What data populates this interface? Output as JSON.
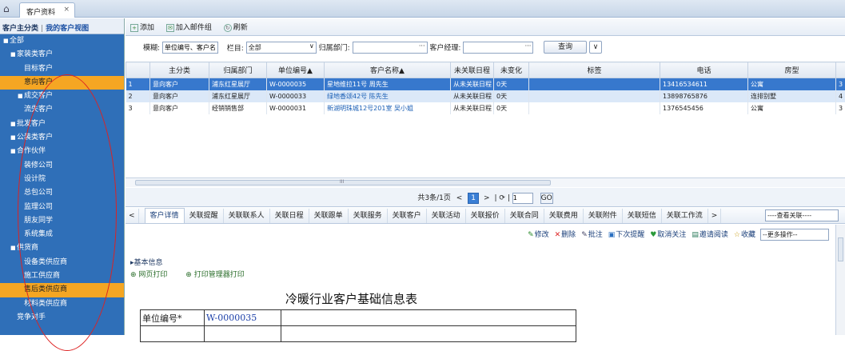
{
  "tabs": {
    "home_icon": "home-icon",
    "active_tab": "客户资料",
    "close": "×"
  },
  "sidebar": {
    "title": "客户主分类",
    "separator": "|",
    "view_link": "我的客户视图",
    "items": [
      {
        "label": "全部",
        "expander": "■",
        "level": 0
      },
      {
        "label": "家装类客户",
        "expander": "■",
        "level": 1
      },
      {
        "label": "目标客户",
        "expander": "",
        "level": 2
      },
      {
        "label": "意向客户",
        "expander": "",
        "level": 2,
        "selected": true
      },
      {
        "label": "成交客户",
        "expander": "■",
        "level": 2
      },
      {
        "label": "流失客户",
        "expander": "",
        "level": 2
      },
      {
        "label": "批发客户",
        "expander": "■",
        "level": 1
      },
      {
        "label": "公装类客户",
        "expander": "■",
        "level": 1
      },
      {
        "label": "合作伙伴",
        "expander": "■",
        "level": 1
      },
      {
        "label": "装修公司",
        "expander": "",
        "level": 2
      },
      {
        "label": "设计院",
        "expander": "",
        "level": 2
      },
      {
        "label": "总包公司",
        "expander": "",
        "level": 2
      },
      {
        "label": "监理公司",
        "expander": "",
        "level": 2
      },
      {
        "label": "朋友同学",
        "expander": "",
        "level": 2
      },
      {
        "label": "系统集成",
        "expander": "",
        "level": 2
      },
      {
        "label": "供货商",
        "expander": "■",
        "level": 1
      },
      {
        "label": "设备类供应商",
        "expander": "",
        "level": 2
      },
      {
        "label": "施工供应商",
        "expander": "",
        "level": 2
      },
      {
        "label": "售后类供应商",
        "expander": "",
        "level": 2,
        "selected": true
      },
      {
        "label": "材料类供应商",
        "expander": "",
        "level": 2
      },
      {
        "label": "竞争对手",
        "expander": "",
        "level": 1
      }
    ]
  },
  "toolbar": {
    "add": "添加",
    "add_mail": "加入邮件组",
    "refresh": "刷新"
  },
  "filter": {
    "fuzzy_label": "模糊:",
    "fuzzy_value": "单位编号、客户名称",
    "column_label": "栏目:",
    "column_value": "全部",
    "dept_label": "归属部门:",
    "dept_value": "",
    "dots": "···",
    "manager_label": "客户经理:",
    "manager_value": "",
    "query": "查询",
    "query_more": "∨"
  },
  "grid": {
    "headers": [
      "",
      "主分类",
      "归属部门",
      "单位编号▲",
      "客户名称▲",
      "未关联日程",
      "未变化",
      "标签",
      "电话",
      "房型",
      ""
    ],
    "rows": [
      [
        "1",
        "意向客户",
        "浦东红星展厅",
        "W-0000035",
        "星地维拉11号 周先生",
        "从未关联日程",
        "0天",
        "",
        "13416534611",
        "公寓",
        "3"
      ],
      [
        "2",
        "意向客户",
        "浦东红星展厅",
        "W-0000033",
        "绿地香颂42号 陈先生",
        "从未关联日程",
        "0天",
        "",
        "13898765876",
        "连排别墅",
        "4"
      ],
      [
        "3",
        "意向客户",
        "经销销售部",
        "W-0000031",
        "新湖明珠城12号201室 吴小姐",
        "从未关联日程",
        "0天",
        "",
        "1376545456",
        "公寓",
        "3"
      ]
    ]
  },
  "hscroll": {
    "grip": "III"
  },
  "pager": {
    "summary": "共3条/1页",
    "prev": "<",
    "page": "1",
    "next": ">",
    "sep": "|",
    "refresh": "⟳",
    "input": "1",
    "go": "GO"
  },
  "detail_tabs": [
    "客户详情",
    "关联提醒",
    "关联联系人",
    "关联日程",
    "关联跟单",
    "关联服务",
    "关联客户",
    "关联活动",
    "关联报价",
    "关联合同",
    "关联费用",
    "关联附件",
    "关联短信",
    "关联工作流"
  ],
  "detail_nav": {
    "left": "<",
    "right": ">",
    "select": "----查看关联----"
  },
  "actions": [
    {
      "icon": "✎",
      "label": "修改",
      "color": "#2a8a2a"
    },
    {
      "icon": "✕",
      "label": "删除",
      "color": "#d22"
    },
    {
      "icon": "✎",
      "label": "批注",
      "color": "#446"
    },
    {
      "icon": "▣",
      "label": "下次提醒",
      "color": "#2a6fc0"
    },
    {
      "icon": "♥",
      "label": "取消关注",
      "color": "#2a9a3a"
    },
    {
      "icon": "▤",
      "label": "邀请阅读",
      "color": "#2a7a5a"
    },
    {
      "icon": "☆",
      "label": "收藏",
      "color": "#c89a10"
    }
  ],
  "more_ops": "--更多操作--",
  "basic_info": "▸基本信息",
  "prints": {
    "web_print": "网页打印",
    "mgr_print": "打印管理器打印"
  },
  "form": {
    "title": "冷暖行业客户基础信息表",
    "code_label": "单位编号*",
    "code_value": "W-0000035"
  }
}
